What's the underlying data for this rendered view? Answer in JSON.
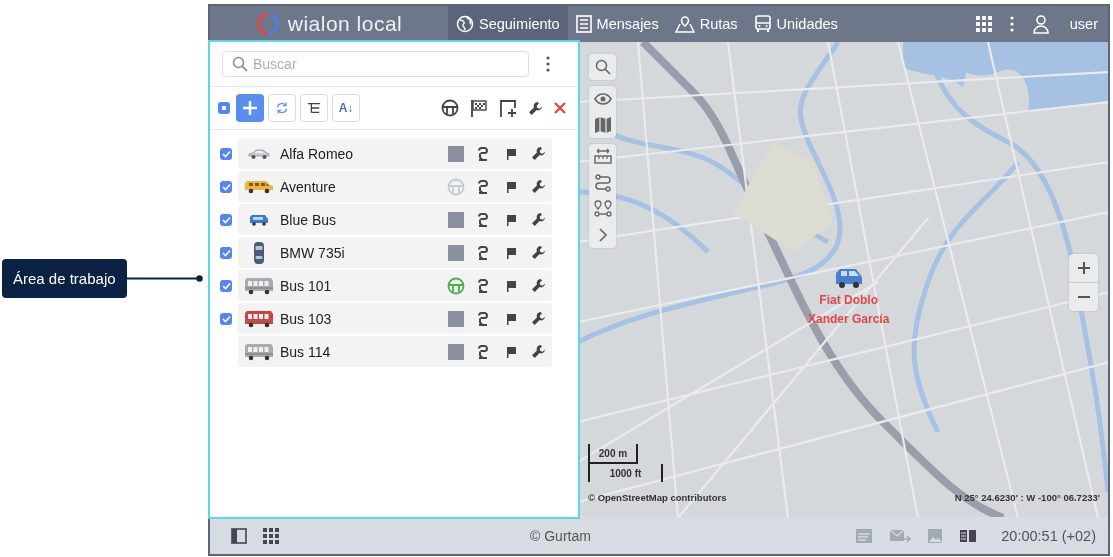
{
  "callout": {
    "label": "Área de trabajo"
  },
  "header": {
    "logo": "wialon local",
    "tabs": [
      {
        "label": "Seguimiento",
        "selected": true
      },
      {
        "label": "Mensajes",
        "selected": false
      },
      {
        "label": "Rutas",
        "selected": false
      },
      {
        "label": "Unidades",
        "selected": false
      }
    ],
    "user": "user"
  },
  "panel": {
    "search": {
      "placeholder": "Buscar"
    },
    "select_all": {
      "indeterminate": true
    },
    "sort_label": "A↓",
    "units": [
      {
        "name": "Alfa Romeo",
        "checked": true,
        "vehicle": {
          "kind": "car",
          "color": "#c9cdd6"
        },
        "driver": {
          "kind": "photo"
        }
      },
      {
        "name": "Aventure",
        "checked": true,
        "vehicle": {
          "kind": "van",
          "color": "#f0b43c"
        },
        "driver": {
          "kind": "wheel",
          "color": "#c4c8d0"
        }
      },
      {
        "name": "Blue Bus",
        "checked": true,
        "vehicle": {
          "kind": "minibus",
          "color": "#3a78c8"
        },
        "driver": {
          "kind": "photo"
        }
      },
      {
        "name": "BMW 735i",
        "checked": true,
        "vehicle": {
          "kind": "car-top",
          "color": "#4a5a78"
        },
        "driver": {
          "kind": "photo"
        }
      },
      {
        "name": "Bus 101",
        "checked": true,
        "vehicle": {
          "kind": "bus",
          "color": "#a8abb0"
        },
        "driver": {
          "kind": "wheel",
          "color": "#4cb050"
        }
      },
      {
        "name": "Bus 103",
        "checked": true,
        "vehicle": {
          "kind": "bus",
          "color": "#d04040"
        },
        "driver": {
          "kind": "photo"
        }
      },
      {
        "name": "Bus 114",
        "checked": false,
        "vehicle": {
          "kind": "bus",
          "color": "#a8abb0"
        },
        "driver": {
          "kind": "photo"
        }
      }
    ]
  },
  "map": {
    "unit": {
      "name": "Fiat Doblo",
      "driver": "Xander García"
    },
    "scale": {
      "metric": "200 m",
      "imperial": "1000 ft"
    },
    "attribution": "© OpenStreetMap contributors",
    "coordinates": "N 25° 24.6230' : W -100° 06.7233'"
  },
  "footer": {
    "copyright": "© Gurtam",
    "time": "20:00:51 (+02)"
  }
}
